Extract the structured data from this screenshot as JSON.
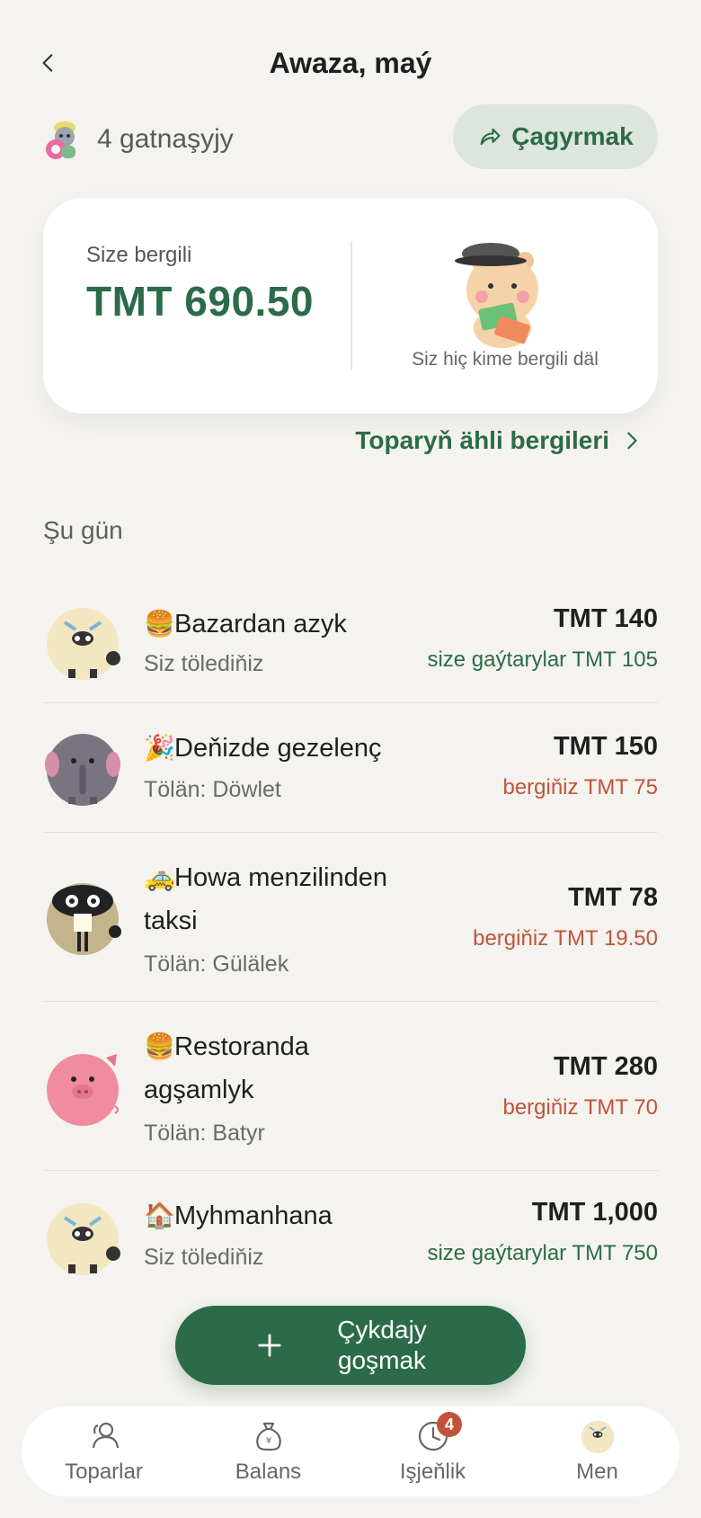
{
  "header": {
    "title": "Awaza, maý",
    "back_icon": "chevron-left-icon"
  },
  "participants": {
    "label": "4 gatnaşyjy"
  },
  "invite": {
    "label": "Çagyrmak",
    "icon": "share-icon"
  },
  "balance_card": {
    "owed_label": "Size bergili",
    "owed_amount": "TMT 690.50",
    "note": "Siz hiç kime bergili däl"
  },
  "all_debts_link": "Toparyň ähli bergileri",
  "section_title": "Şu gün",
  "expenses": [
    {
      "emoji": "🍔",
      "title": "Bazardan azyk",
      "subtitle": "Siz tölediňiz",
      "amount": "TMT 140",
      "balance": "size gaýtarylar TMT 105",
      "balance_type": "green",
      "avatar": "sheep"
    },
    {
      "emoji": "🎉",
      "title": "Deňizde gezelenç",
      "subtitle": "Tölän: Döwlet",
      "amount": "TMT 150",
      "balance": "bergiňiz TMT 75",
      "balance_type": "red",
      "avatar": "elephant"
    },
    {
      "emoji": "🚕",
      "title": "Howa menzilinden taksi",
      "subtitle": "Tölän: Gülälek",
      "amount": "TMT 78",
      "balance": "bergiňiz TMT 19.50",
      "balance_type": "red",
      "avatar": "raccoon"
    },
    {
      "emoji": "🍔",
      "title": "Restoranda agşamlyk",
      "subtitle": "Tölän: Batyr",
      "amount": "TMT 280",
      "balance": "bergiňiz TMT 70",
      "balance_type": "red",
      "avatar": "pig"
    },
    {
      "emoji": "🏠",
      "title": "Myhmanhana",
      "subtitle": "Siz tölediňiz",
      "amount": "TMT 1,000",
      "balance": "size gaýtarylar TMT 750",
      "balance_type": "green",
      "avatar": "sheep"
    }
  ],
  "add_button": {
    "label": "Çykdajy goşmak",
    "icon": "plus-icon"
  },
  "nav": {
    "items": [
      {
        "label": "Toparlar",
        "icon": "users-icon"
      },
      {
        "label": "Balans",
        "icon": "money-bag-icon"
      },
      {
        "label": "Işjeňlik",
        "icon": "clock-icon",
        "badge": "4"
      },
      {
        "label": "Men",
        "icon": "avatar"
      }
    ]
  },
  "colors": {
    "accent": "#2b6b4a",
    "owe": "#c0533a",
    "bg": "#f4f3ef"
  }
}
